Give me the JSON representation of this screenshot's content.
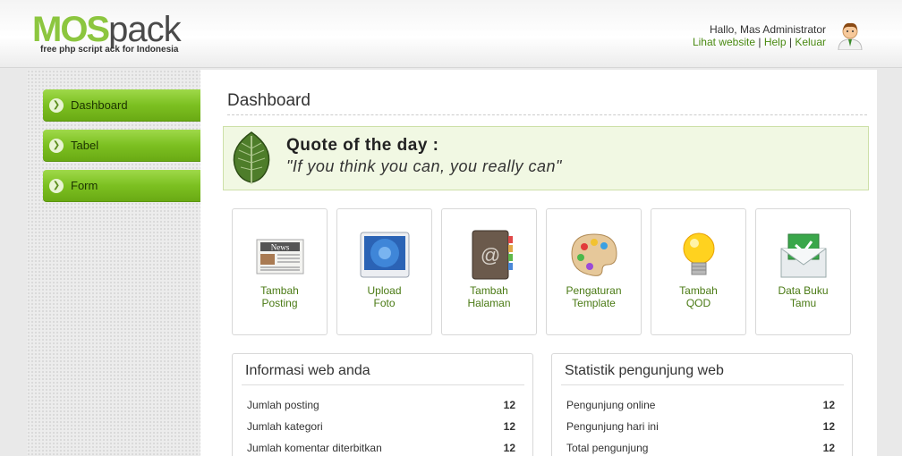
{
  "header": {
    "logo_mos": "MOS",
    "logo_pack": "pack",
    "logo_tagline": "free php script  ack for Indonesia",
    "greeting": "Hallo, Mas Administrator",
    "links": [
      {
        "label": "Lihat website"
      },
      {
        "label": "Help"
      },
      {
        "label": "Keluar"
      }
    ],
    "separator": "|"
  },
  "sidebar": {
    "items": [
      {
        "label": "Dashboard",
        "icon": "chevron-right-icon"
      },
      {
        "label": "Tabel",
        "icon": "chevron-right-icon"
      },
      {
        "label": "Form",
        "icon": "chevron-right-icon"
      }
    ]
  },
  "main": {
    "title": "Dashboard",
    "quote": {
      "title": "Quote of the day :",
      "text": "\"If you think you can, you really can\"",
      "icon": "leaf-icon"
    },
    "shortcuts": [
      {
        "line1": "Tambah",
        "line2": "Posting",
        "icon": "news-icon",
        "icon_text": "News"
      },
      {
        "line1": "Upload",
        "line2": "Foto",
        "icon": "photo-icon"
      },
      {
        "line1": "Tambah",
        "line2": "Halaman",
        "icon": "address-book-icon"
      },
      {
        "line1": "Pengaturan",
        "line2": "Template",
        "icon": "palette-icon"
      },
      {
        "line1": "Tambah",
        "line2": "QOD",
        "icon": "lightbulb-icon"
      },
      {
        "line1": "Data Buku",
        "line2": "Tamu",
        "icon": "envelope-icon"
      }
    ],
    "info_panel": {
      "title": "Informasi web anda",
      "rows": [
        {
          "label": "Jumlah posting",
          "value": "12"
        },
        {
          "label": "Jumlah kategori",
          "value": "12"
        },
        {
          "label": "Jumlah komentar diterbitkan",
          "value": "12"
        }
      ]
    },
    "stats_panel": {
      "title": "Statistik pengunjung web",
      "rows": [
        {
          "label": "Pengunjung online",
          "value": "12"
        },
        {
          "label": "Pengunjung hari ini",
          "value": "12"
        },
        {
          "label": "Total pengunjung",
          "value": "12"
        }
      ]
    }
  },
  "colors": {
    "accent_green": "#8cc63f",
    "link_green": "#4a8a12",
    "quote_bg": "#f1f8e3"
  }
}
